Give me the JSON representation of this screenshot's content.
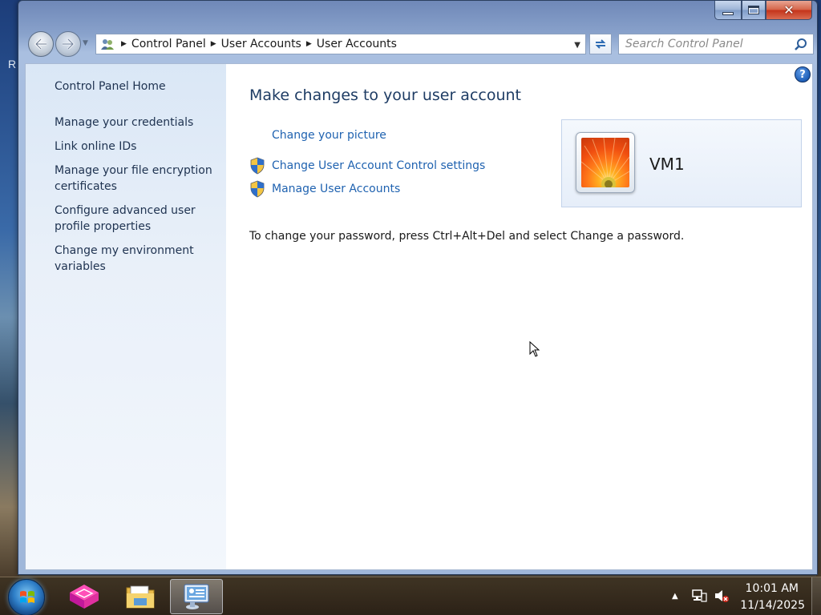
{
  "desktop": {
    "edge_letter": "R"
  },
  "window": {
    "caption": {
      "minimize_glyph": "",
      "maximize_glyph": "",
      "close_glyph": "✕"
    }
  },
  "navbar": {
    "breadcrumbs": [
      "Control Panel",
      "User Accounts",
      "User Accounts"
    ],
    "search_placeholder": "Search Control Panel"
  },
  "sidebar": {
    "items": [
      {
        "label": "Control Panel Home"
      },
      {
        "label": "Manage your credentials"
      },
      {
        "label": "Link online IDs"
      },
      {
        "label": "Manage your file encryption certificates"
      },
      {
        "label": "Configure advanced user profile properties"
      },
      {
        "label": "Change my environment variables"
      }
    ]
  },
  "main": {
    "title": "Make changes to your user account",
    "tasks": [
      {
        "label": "Change your picture",
        "icon": "none"
      },
      {
        "label": "Change User Account Control settings",
        "icon": "uac-shield-icon"
      },
      {
        "label": "Manage User Accounts",
        "icon": "uac-shield-icon"
      }
    ],
    "note": "To change your password, press Ctrl+Alt+Del and select Change a password.",
    "account": {
      "name": "VM1",
      "picture": "orange-flower"
    },
    "help_label": "?"
  },
  "taskbar": {
    "pinned": [
      {
        "name": "start-button"
      },
      {
        "name": "app-pink-cube"
      },
      {
        "name": "windows-explorer"
      },
      {
        "name": "control-panel",
        "active": true
      }
    ],
    "clock": {
      "time": "10:01 AM",
      "date": "11/14/2025"
    }
  },
  "colors": {
    "link": "#1f62b0",
    "title": "#1e3c64",
    "sidebar_text": "#1e3250",
    "close_button": "#c4331a"
  }
}
